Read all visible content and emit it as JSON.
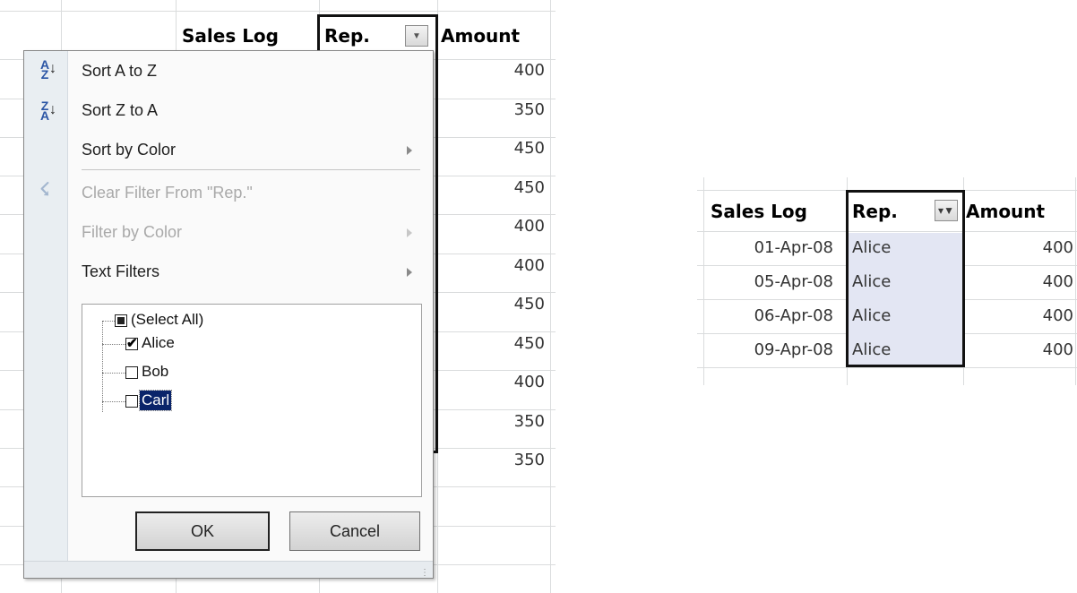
{
  "left_sheet": {
    "headers": {
      "col_b": "Sales Log",
      "col_c": "Rep.",
      "col_d": "Amount"
    },
    "amounts": [
      "400",
      "350",
      "450",
      "450",
      "400",
      "400",
      "450",
      "450",
      "400",
      "350",
      "350"
    ]
  },
  "filter_menu": {
    "sort_az": "Sort A to Z",
    "sort_za": "Sort Z to A",
    "sort_by_color": "Sort by Color",
    "clear_filter": "Clear Filter From \"Rep.\"",
    "filter_by_color": "Filter by Color",
    "text_filters": "Text Filters",
    "list_items": [
      {
        "label": "(Select All)",
        "state": "partial"
      },
      {
        "label": "Alice",
        "state": "checked"
      },
      {
        "label": "Bob",
        "state": "unchecked"
      },
      {
        "label": "Carl",
        "state": "unchecked",
        "focused": true
      }
    ],
    "ok_label": "OK",
    "cancel_label": "Cancel"
  },
  "right_sheet": {
    "headers": {
      "col_b": "Sales Log",
      "col_c": "Rep.",
      "col_d": "Amount"
    },
    "rows": [
      {
        "date": "01-Apr-08",
        "rep": "Alice",
        "amount": "400"
      },
      {
        "date": "05-Apr-08",
        "rep": "Alice",
        "amount": "400"
      },
      {
        "date": "06-Apr-08",
        "rep": "Alice",
        "amount": "400"
      },
      {
        "date": "09-Apr-08",
        "rep": "Alice",
        "amount": "400"
      }
    ]
  },
  "colors": {
    "gridline": "#dadcdd",
    "filtered_cell_bg": "#e3e6f3",
    "focus_highlight": "#0a246a"
  }
}
